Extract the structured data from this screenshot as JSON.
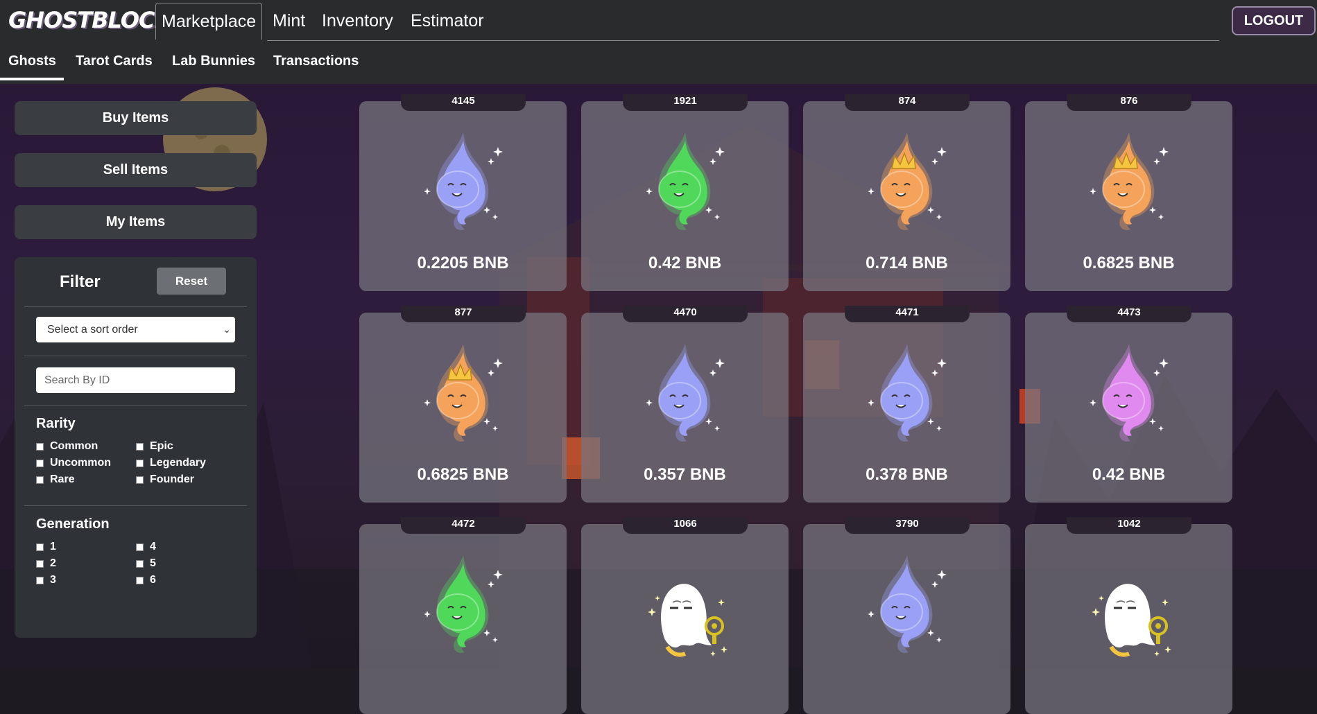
{
  "brand": {
    "logo_text": "GHOSTBLOCK"
  },
  "main_nav": [
    {
      "label": "Marketplace",
      "active": true
    },
    {
      "label": "Mint",
      "active": false
    },
    {
      "label": "Inventory",
      "active": false
    },
    {
      "label": "Estimator",
      "active": false
    }
  ],
  "logout_label": "LOGOUT",
  "sub_tabs": [
    {
      "label": "Ghosts",
      "active": true
    },
    {
      "label": "Tarot Cards",
      "active": false
    },
    {
      "label": "Lab Bunnies",
      "active": false
    },
    {
      "label": "Transactions",
      "active": false
    }
  ],
  "sidebar": {
    "buy_label": "Buy Items",
    "sell_label": "Sell Items",
    "my_items_label": "My Items"
  },
  "filter": {
    "title": "Filter",
    "reset_label": "Reset",
    "sort_placeholder": "Select a sort order",
    "search_placeholder": "Search By ID",
    "rarity_title": "Rarity",
    "rarity_options": [
      "Common",
      "Uncommon",
      "Rare",
      "Epic",
      "Legendary",
      "Founder"
    ],
    "generation_title": "Generation",
    "generation_options": [
      "1",
      "2",
      "3",
      "4",
      "5",
      "6"
    ]
  },
  "colors": {
    "blue": "#9aa0f5",
    "green": "#4fd85a",
    "orange": "#f5a35a",
    "purple": "#e08af0",
    "white": "#ffffff",
    "accent": "#3d2a47"
  },
  "items": [
    {
      "id": "4145",
      "price": "0.2205 BNB",
      "variant": "blue"
    },
    {
      "id": "1921",
      "price": "0.42 BNB",
      "variant": "green"
    },
    {
      "id": "874",
      "price": "0.714 BNB",
      "variant": "orange-crown"
    },
    {
      "id": "876",
      "price": "0.6825 BNB",
      "variant": "orange-crown"
    },
    {
      "id": "877",
      "price": "0.6825 BNB",
      "variant": "orange-crown"
    },
    {
      "id": "4470",
      "price": "0.357 BNB",
      "variant": "blue"
    },
    {
      "id": "4471",
      "price": "0.378 BNB",
      "variant": "blue"
    },
    {
      "id": "4473",
      "price": "0.42 BNB",
      "variant": "purple"
    },
    {
      "id": "4472",
      "price": "",
      "variant": "green"
    },
    {
      "id": "1066",
      "price": "",
      "variant": "white-ghost"
    },
    {
      "id": "3790",
      "price": "",
      "variant": "blue"
    },
    {
      "id": "1042",
      "price": "",
      "variant": "white-ghost"
    }
  ]
}
